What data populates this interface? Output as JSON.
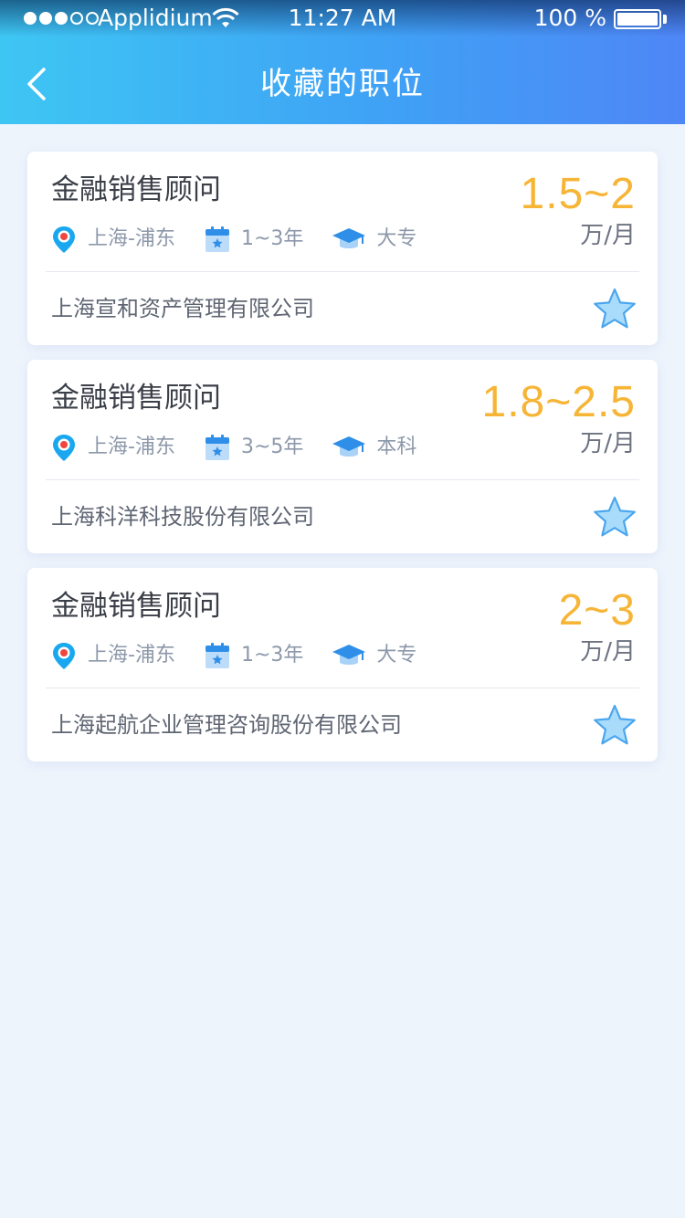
{
  "status_bar": {
    "carrier": "Applidium",
    "time": "11:27 AM",
    "battery": "100 %"
  },
  "nav": {
    "title": "收藏的职位",
    "back_icon": "chevron-left-icon"
  },
  "colors": {
    "header_gradient": [
      "#3ec6f3",
      "#4e86f6"
    ],
    "salary": "#f6b537",
    "star_fill": "#a9dcfa",
    "star_stroke": "#4aa6ee",
    "background": "#eef4fc"
  },
  "jobs": [
    {
      "title": "金融销售顾问",
      "salary": "1.5~2",
      "unit": "万/月",
      "location": "上海-浦东",
      "experience": "1~3年",
      "education": "大专",
      "company": "上海宣和资产管理有限公司",
      "favorited": true
    },
    {
      "title": "金融销售顾问",
      "salary": "1.8~2.5",
      "unit": "万/月",
      "location": "上海-浦东",
      "experience": "3~5年",
      "education": "本科",
      "company": "上海科洋科技股份有限公司",
      "favorited": true
    },
    {
      "title": "金融销售顾问",
      "salary": "2~3",
      "unit": "万/月",
      "location": "上海-浦东",
      "experience": "1~3年",
      "education": "大专",
      "company": "上海起航企业管理咨询股份有限公司",
      "favorited": true
    }
  ]
}
